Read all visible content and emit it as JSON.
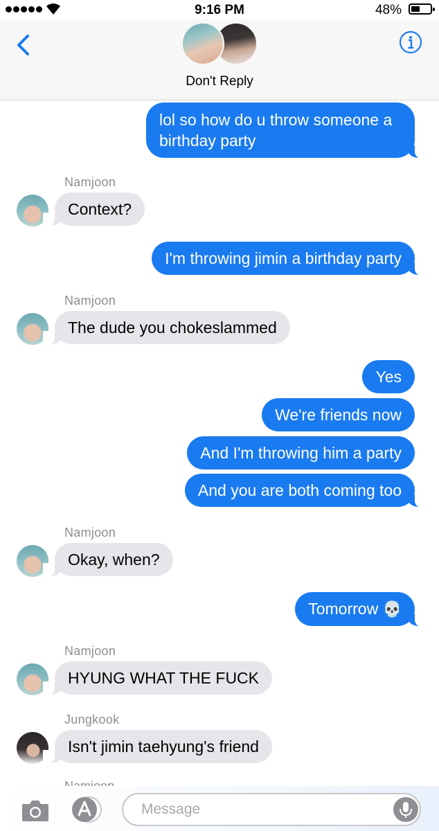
{
  "status_bar": {
    "time": "9:16 PM",
    "battery_percent_label": "48%",
    "battery_level": 0.48,
    "signal_dots": 5
  },
  "header": {
    "title": "Don't Reply",
    "back_icon": "chevron-left-icon",
    "info_icon": "info-icon",
    "accent_color": "#1a7bf0"
  },
  "messages": [
    {
      "side": "sent",
      "text": "lol so how do u throw someone a birthday party"
    },
    {
      "side": "received",
      "sender": "Namjoon",
      "text": "Context?"
    },
    {
      "side": "sent",
      "text": "I'm throwing jimin a birthday party"
    },
    {
      "side": "received",
      "sender": "Namjoon",
      "text": "The dude you chokeslammed"
    },
    {
      "side": "sent",
      "text": "Yes"
    },
    {
      "side": "sent",
      "text": "We're friends now"
    },
    {
      "side": "sent",
      "text": "And I'm throwing him a party"
    },
    {
      "side": "sent",
      "text": "And you are both coming too"
    },
    {
      "side": "received",
      "sender": "Namjoon",
      "text": "Okay, when?"
    },
    {
      "side": "sent",
      "text": "Tomorrow",
      "emoji": "💀"
    },
    {
      "side": "received",
      "sender": "Namjoon",
      "text": "HYUNG WHAT THE FUCK"
    },
    {
      "side": "received",
      "sender": "Jungkook",
      "text": "Isn't jimin taehyung's friend"
    }
  ],
  "partial_sender": "Namjoon",
  "input_bar": {
    "placeholder": "Message",
    "camera_icon": "camera-icon",
    "apps_icon": "app-store-icon",
    "mic_icon": "microphone-icon"
  },
  "colors": {
    "sent_bubble": "#1a7bf0",
    "received_bubble": "#e6e6ea",
    "sender_label": "#8e8e93"
  }
}
